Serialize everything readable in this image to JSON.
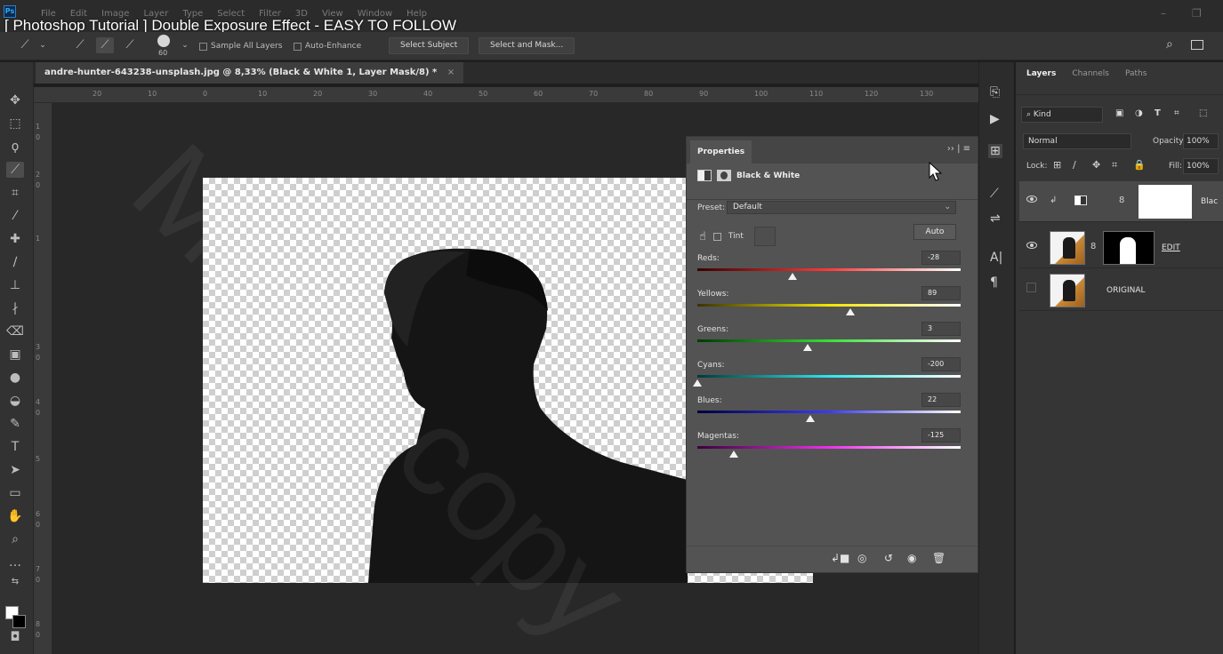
{
  "video_title": "[ Photoshop Tutorial ] Double Exposure Effect - EASY TO FOLLOW",
  "menubar": {
    "logo": "Ps",
    "items": [
      "File",
      "Edit",
      "Image",
      "Layer",
      "Type",
      "Select",
      "Filter",
      "3D",
      "View",
      "Window",
      "Help"
    ]
  },
  "options_bar": {
    "brush_size": "60",
    "sample_all_layers": "Sample All Layers",
    "auto_enhance": "Auto-Enhance",
    "select_subject": "Select Subject",
    "select_and_mask": "Select and Mask..."
  },
  "document_tab": {
    "title": "andre-hunter-643238-unsplash.jpg @ 8,33% (Black & White 1, Layer Mask/8) *",
    "close": "×"
  },
  "ruler": {
    "h_ticks": [
      "20",
      "10",
      "0",
      "10",
      "20",
      "30",
      "40",
      "50",
      "60",
      "70",
      "80",
      "90",
      "100",
      "110",
      "120",
      "130"
    ],
    "v_ticks": [
      "1",
      "0",
      "2",
      "0",
      "1",
      "3",
      "0",
      "4",
      "0",
      "5",
      "6",
      "0",
      "7",
      "0",
      "8",
      "0"
    ]
  },
  "properties": {
    "tab_label": "Properties",
    "adjustment_label": "Black & White",
    "preset_label": "Preset:",
    "preset_value": "Default",
    "tint_label": "Tint",
    "auto_label": "Auto",
    "sliders": [
      {
        "label": "Reds:",
        "value": "-28",
        "level": 0.36,
        "gradient": "linear-gradient(90deg,#3a0000,#ff3a3a,#ffffff)"
      },
      {
        "label": "Yellows:",
        "value": "89",
        "level": 0.58,
        "gradient": "linear-gradient(90deg,#3a3300,#f2e600,#ffffff)"
      },
      {
        "label": "Greens:",
        "value": "3",
        "level": 0.42,
        "gradient": "linear-gradient(90deg,#003a00,#36e036,#ffffff)"
      },
      {
        "label": "Cyans:",
        "value": "-200",
        "level": 0.0,
        "gradient": "linear-gradient(90deg,#003a3a,#2ee6ee,#ffffff)"
      },
      {
        "label": "Blues:",
        "value": "22",
        "level": 0.43,
        "gradient": "linear-gradient(90deg,#00003a,#3a3aff,#ffffff)"
      },
      {
        "label": "Magentas:",
        "value": "-125",
        "level": 0.14,
        "gradient": "linear-gradient(90deg,#3a003a,#ee2eee,#ffffff)"
      }
    ]
  },
  "layers_panel": {
    "tabs": [
      "Layers",
      "Channels",
      "Paths"
    ],
    "kind_label": "Kind",
    "blend_mode": "Normal",
    "opacity_label": "Opacity:",
    "opacity_value": "100%",
    "lock_label": "Lock:",
    "fill_label": "Fill:",
    "fill_value": "100%",
    "layers": [
      {
        "name": "Blac",
        "visible": true,
        "selected": true
      },
      {
        "name": "EDIT",
        "visible": true,
        "selected": false
      },
      {
        "name": "ORIGINAL",
        "visible": false,
        "selected": false
      }
    ]
  },
  "watermark": "Maiigr copy",
  "colors": {
    "accent": "#31a8ff",
    "fg_color": "#ffffff",
    "bg_color": "#000000"
  }
}
